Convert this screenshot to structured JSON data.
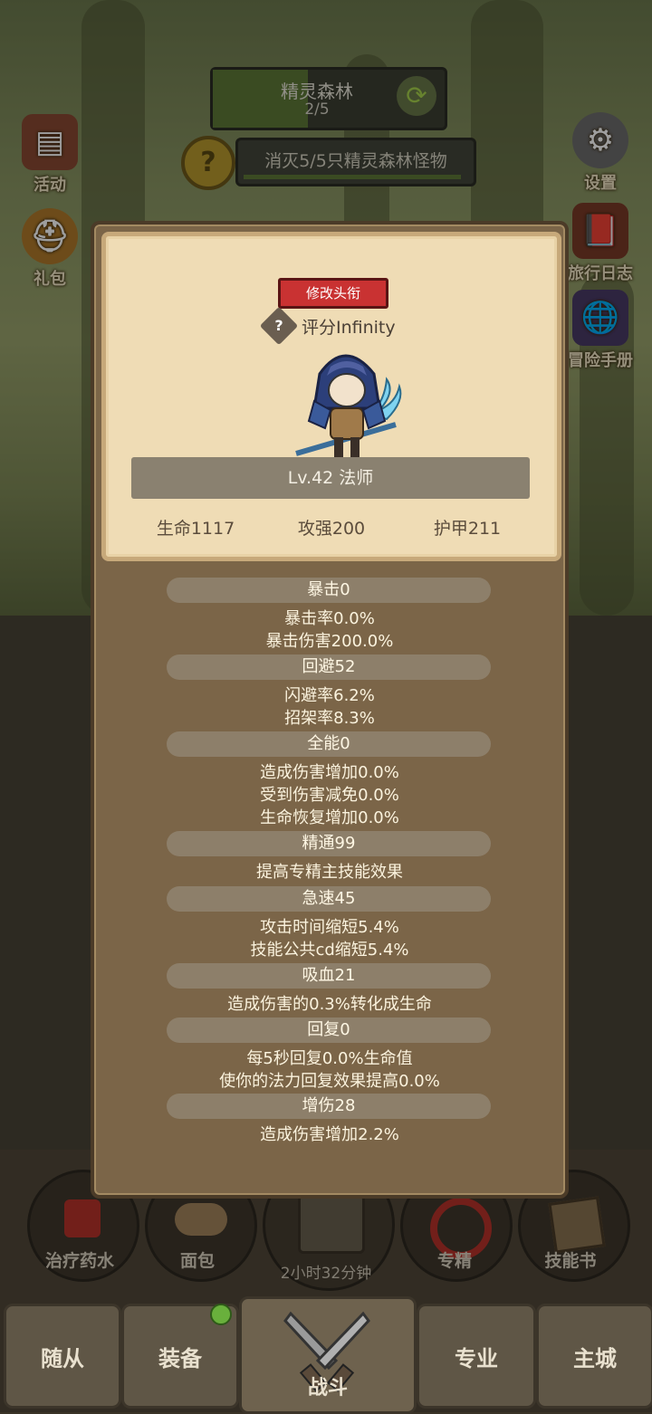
{
  "hud": {
    "zone_name": "精灵森林",
    "zone_progress": "2/5",
    "zone_fill_fraction": 0.42,
    "quest_text": "消灭5/5只精灵森林怪物",
    "quest_fraction": 1.0
  },
  "side_left": [
    {
      "label": "活动",
      "icon": "bulletin-board-icon"
    },
    {
      "label": "礼包",
      "icon": "helmet-coin-icon"
    }
  ],
  "side_right": [
    {
      "label": "设置",
      "icon": "gear-icon"
    },
    {
      "label": "旅行日志",
      "icon": "journal-book-icon"
    },
    {
      "label": "冒险手册",
      "icon": "globe-book-icon"
    }
  ],
  "modal": {
    "title_button": "修改头衔",
    "score": "评分Infinity",
    "level_class": "Lv.42 法师",
    "stats": {
      "hp": "生命1117",
      "atk": "攻强200",
      "armor": "护甲211"
    },
    "sections": [
      {
        "header": "暴击0",
        "lines": [
          "暴击率0.0%",
          "暴击伤害200.0%"
        ]
      },
      {
        "header": "回避52",
        "lines": [
          "闪避率6.2%",
          "招架率8.3%"
        ]
      },
      {
        "header": "全能0",
        "lines": [
          "造成伤害增加0.0%",
          "受到伤害减免0.0%",
          "生命恢复增加0.0%"
        ]
      },
      {
        "header": "精通99",
        "lines": [
          "提高专精主技能效果"
        ]
      },
      {
        "header": "急速45",
        "lines": [
          "攻击时间缩短5.4%",
          "技能公共cd缩短5.4%"
        ]
      },
      {
        "header": "吸血21",
        "lines": [
          "造成伤害的0.3%转化成生命"
        ]
      },
      {
        "header": "回复0",
        "lines": [
          "每5秒回复0.0%生命值",
          "使你的法力回复效果提高0.0%"
        ]
      },
      {
        "header": "增伤28",
        "lines": [
          "造成伤害增加2.2%"
        ]
      }
    ]
  },
  "items": [
    {
      "label": "治疗药水",
      "icon": "potion-icon"
    },
    {
      "label": "面包",
      "icon": "bread-icon"
    },
    {
      "label": "专精",
      "icon": "specialization-icon"
    },
    {
      "label": "技能书",
      "icon": "skill-book-icon"
    }
  ],
  "timer": "2小时32分钟",
  "nav": [
    "随从",
    "装备",
    "战斗",
    "专业",
    "主城"
  ]
}
